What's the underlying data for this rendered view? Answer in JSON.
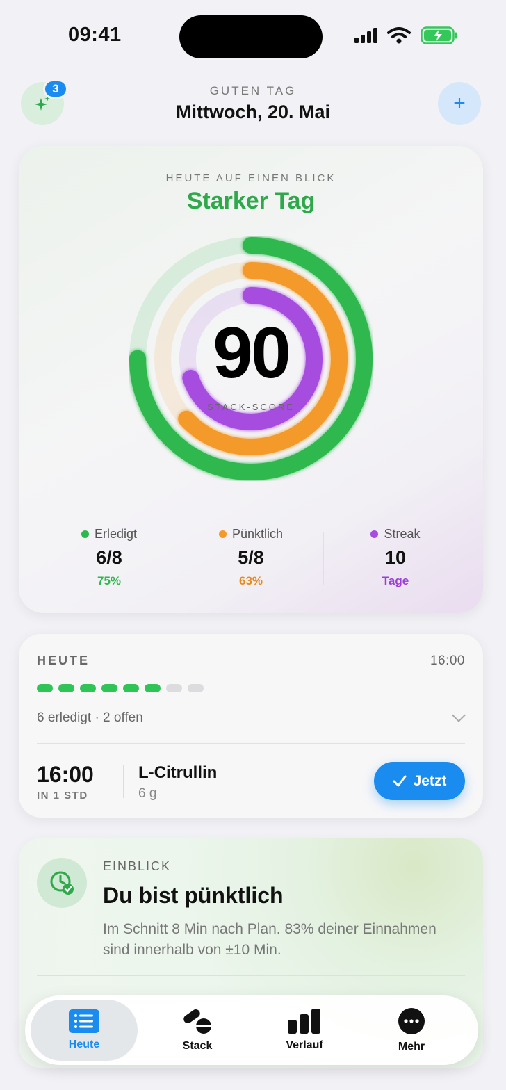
{
  "status_bar": {
    "time": "09:41"
  },
  "header": {
    "notification_count": "3",
    "greeting": "GUTEN TAG",
    "date": "Mittwoch, 20. Mai",
    "add_label": "+"
  },
  "summary": {
    "kicker": "HEUTE AUF EINEN BLICK",
    "title": "Starker Tag",
    "score": "90",
    "score_label": "STACK-SCORE",
    "rings": [
      {
        "name": "Erledigt",
        "fraction": 0.75,
        "color": "#2db84d"
      },
      {
        "name": "Pünktlich",
        "fraction": 0.63,
        "color": "#f39a2a"
      },
      {
        "name": "Streak",
        "fraction": 0.7,
        "color": "#a64de0"
      }
    ],
    "stats": [
      {
        "label": "Erledigt",
        "value": "6/8",
        "sub": "75%",
        "color": "#2db84d"
      },
      {
        "label": "Pünktlich",
        "value": "5/8",
        "sub": "63%",
        "color": "#e8891c"
      },
      {
        "label": "Streak",
        "value": "10",
        "sub": "Tage",
        "color": "#9b3fd6"
      }
    ]
  },
  "today": {
    "title": "HEUTE",
    "time": "16:00",
    "done": 6,
    "total": 8,
    "summary": "6 erledigt · 2 offen",
    "next": {
      "time": "16:00",
      "relative": "IN 1 STD",
      "name": "L-Citrullin",
      "dose": "6 g",
      "action": "Jetzt"
    }
  },
  "insight": {
    "kicker": "EINBLICK",
    "title": "Du bist pünktlich",
    "body": "Im Schnitt 8 Min nach Plan. 83% deiner Einnahmen sind innerhalb von ±10 Min."
  },
  "tabs": [
    {
      "label": "Heute",
      "icon": "list-icon",
      "active": true
    },
    {
      "label": "Stack",
      "icon": "pills-icon",
      "active": false
    },
    {
      "label": "Verlauf",
      "icon": "bar-chart-icon",
      "active": false
    },
    {
      "label": "Mehr",
      "icon": "more-icon",
      "active": false
    }
  ]
}
